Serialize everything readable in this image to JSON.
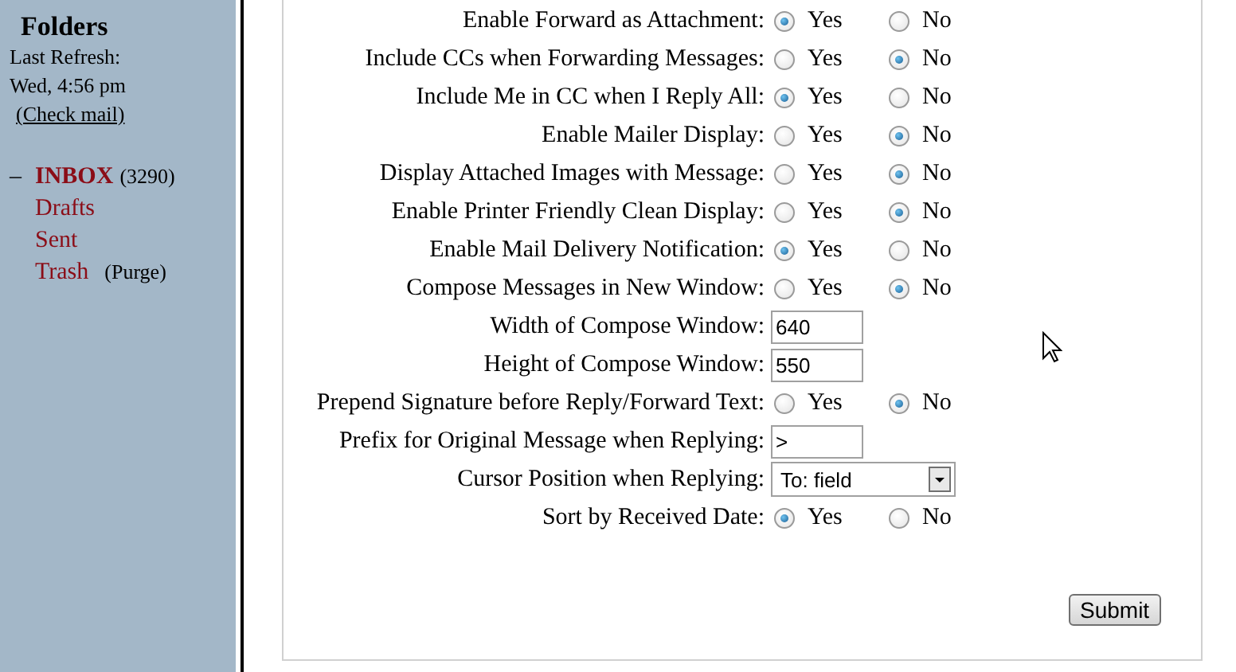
{
  "sidebar": {
    "title": "Folders",
    "refresh_label": "Last Refresh:",
    "refresh_time": "Wed, 4:56 pm",
    "check_mail": "(Check mail)",
    "folders": [
      {
        "expander": "–",
        "name": "INBOX",
        "count": "(3290)",
        "selected": true
      },
      {
        "name": "Drafts",
        "selected": false
      },
      {
        "name": "Sent",
        "selected": false
      },
      {
        "name": "Trash",
        "action": "(Purge)",
        "selected": false
      }
    ]
  },
  "options": [
    {
      "kind": "radio",
      "label": "Enable Forward as Attachment:",
      "choices": [
        {
          "label": "Yes",
          "selected": true
        },
        {
          "label": "No",
          "selected": false
        }
      ]
    },
    {
      "kind": "radio",
      "label": "Include CCs when Forwarding Messages:",
      "choices": [
        {
          "label": "Yes",
          "selected": false
        },
        {
          "label": "No",
          "selected": true
        }
      ]
    },
    {
      "kind": "radio",
      "label": "Include Me in CC when I Reply All:",
      "choices": [
        {
          "label": "Yes",
          "selected": true
        },
        {
          "label": "No",
          "selected": false
        }
      ]
    },
    {
      "kind": "radio",
      "label": "Enable Mailer Display:",
      "choices": [
        {
          "label": "Yes",
          "selected": false
        },
        {
          "label": "No",
          "selected": true
        }
      ]
    },
    {
      "kind": "radio",
      "label": "Display Attached Images with Message:",
      "choices": [
        {
          "label": "Yes",
          "selected": false
        },
        {
          "label": "No",
          "selected": true
        }
      ]
    },
    {
      "kind": "radio",
      "label": "Enable Printer Friendly Clean Display:",
      "choices": [
        {
          "label": "Yes",
          "selected": false
        },
        {
          "label": "No",
          "selected": true
        }
      ]
    },
    {
      "kind": "radio",
      "label": "Enable Mail Delivery Notification:",
      "choices": [
        {
          "label": "Yes",
          "selected": true
        },
        {
          "label": "No",
          "selected": false
        }
      ]
    },
    {
      "kind": "radio",
      "label": "Compose Messages in New Window:",
      "choices": [
        {
          "label": "Yes",
          "selected": false
        },
        {
          "label": "No",
          "selected": true
        }
      ]
    },
    {
      "kind": "text",
      "label": "Width of Compose Window:",
      "value": "640"
    },
    {
      "kind": "text",
      "label": "Height of Compose Window:",
      "value": "550"
    },
    {
      "kind": "radio",
      "label": "Prepend Signature before Reply/Forward Text:",
      "choices": [
        {
          "label": "Yes",
          "selected": false
        },
        {
          "label": "No",
          "selected": true
        }
      ]
    },
    {
      "kind": "text",
      "label": "Prefix for Original Message when Replying:",
      "value": ">"
    },
    {
      "kind": "select",
      "label": "Cursor Position when Replying:",
      "value": "To: field"
    },
    {
      "kind": "radio",
      "label": "Sort by Received Date:",
      "choices": [
        {
          "label": "Yes",
          "selected": true
        },
        {
          "label": "No",
          "selected": false
        }
      ]
    }
  ],
  "submit": "Submit"
}
